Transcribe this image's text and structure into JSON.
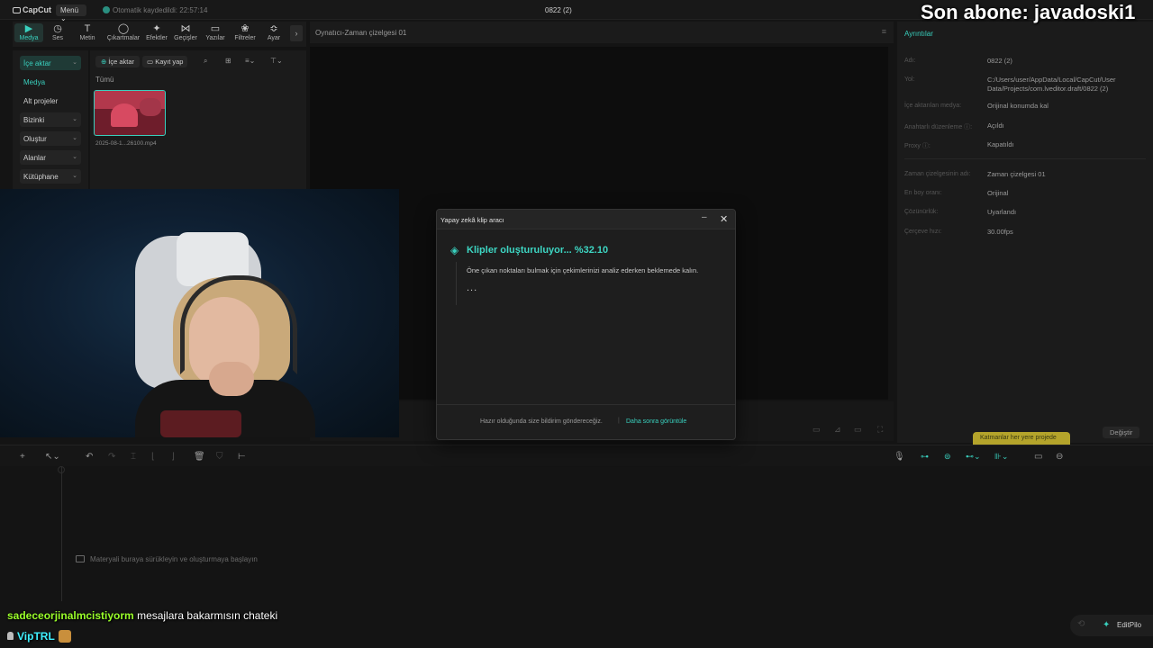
{
  "app": {
    "logo": "CapCut",
    "menu_label": "Menü",
    "autosave": "Otomatik kaydedildi: 22:57:14",
    "project_title": "0822 (2)"
  },
  "overlay": {
    "subscriber": "Son abone: javadoski1"
  },
  "toolbar": {
    "items": [
      {
        "label": "Medya",
        "icon": "▶"
      },
      {
        "label": "Ses",
        "icon": "◷"
      },
      {
        "label": "Metin",
        "icon": "T"
      },
      {
        "label": "Çıkartmalar",
        "icon": "◯"
      },
      {
        "label": "Efektler",
        "icon": "✦"
      },
      {
        "label": "Geçişler",
        "icon": "⋈"
      },
      {
        "label": "Yazılar",
        "icon": "▭"
      },
      {
        "label": "Filtreler",
        "icon": "❀"
      },
      {
        "label": "Ayar",
        "icon": "≎"
      }
    ],
    "collapse_icon": "›"
  },
  "left_panel": {
    "import_label": "İçe aktar",
    "items": [
      "Medya",
      "Alt projeler",
      "Bizinki",
      "Oluştur",
      "Alanlar",
      "Kütüphane"
    ]
  },
  "media": {
    "import_button": "İçe aktar",
    "record_button": "Kayıt yap",
    "all_label": "Tümü",
    "thumb_name": "2025-08-1...26100.mp4"
  },
  "player": {
    "title": "Oynatıcı-Zaman çizelgesi 01"
  },
  "details": {
    "title": "Ayrıntılar",
    "rows": [
      {
        "label": "Adı:",
        "value": "0822 (2)"
      },
      {
        "label": "Yol:",
        "value": "C:/Users/user/AppData/Local/CapCut/User Data/Projects/com.lveditor.draft/0822 (2)"
      },
      {
        "label": "İçe aktarılan medya:",
        "value": "Orijinal konumda kal"
      },
      {
        "label": "Anahtarlı düzenleme ⓘ:",
        "value": "Açıldı"
      },
      {
        "label": "Proxy ⓘ:",
        "value": "Kapatıldı"
      },
      {
        "label": "Zaman çizelgesinin adı:",
        "value": "Zaman çizelgesi 01"
      },
      {
        "label": "En boy oranı:",
        "value": "Orijinal"
      },
      {
        "label": "Çözünürlük:",
        "value": "Uyarlandı"
      },
      {
        "label": "Çerçeve hızı:",
        "value": "30.00fps"
      }
    ],
    "yellow_label": "Katmanlar her yere projede",
    "change_button": "Değiştir"
  },
  "timeline": {
    "drop_hint": "Materyali buraya sürükleyin ve oluşturmaya başlayın"
  },
  "dialog": {
    "title": "Yapay zekâ klip aracı",
    "status": "Klipler oluşturuluyor... %32.10",
    "progress_percent": 32.1,
    "description": "Öne çıkan noktaları bulmak için çekimlerinizi analiz ederken beklemede kalın.",
    "dots": "...",
    "notify_text": "Hazır olduğunda size bildirim göndereceğiz.",
    "later_link": "Daha sonra görüntüle"
  },
  "chat": [
    {
      "user": "sadeceorjinalmcistiyorm",
      "message": "mesajlara bakarmısın chateki"
    },
    {
      "user": "VipTRL",
      "message": ""
    }
  ],
  "editpilot": {
    "label": "EditPilo"
  },
  "colors": {
    "accent": "#39d0be",
    "background": "#141414",
    "panel": "#1b1b1b"
  }
}
